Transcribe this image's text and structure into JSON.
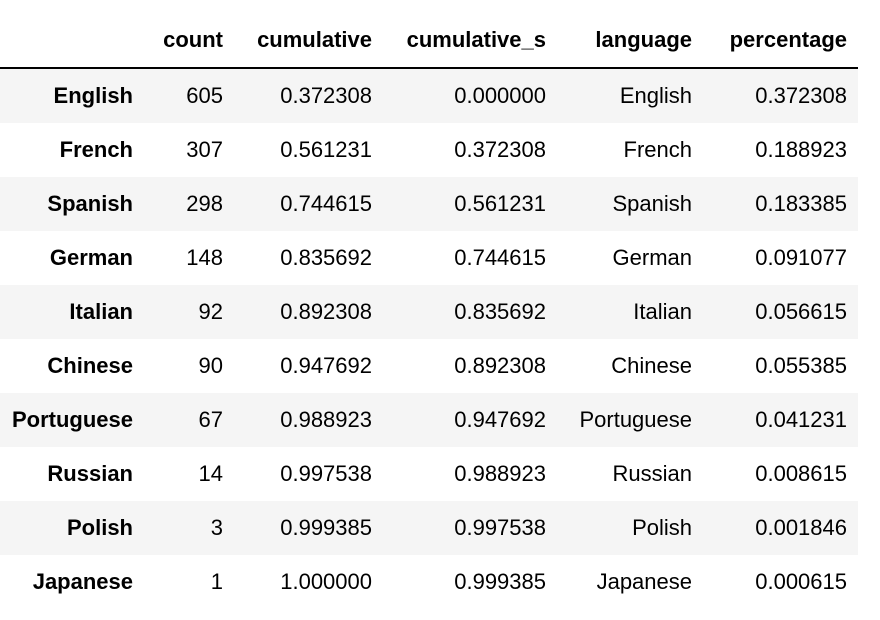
{
  "columns": [
    "",
    "count",
    "cumulative",
    "cumulative_s",
    "language",
    "percentage"
  ],
  "rows": [
    {
      "index": "English",
      "cells": [
        "605",
        "0.372308",
        "0.000000",
        "English",
        "0.372308"
      ]
    },
    {
      "index": "French",
      "cells": [
        "307",
        "0.561231",
        "0.372308",
        "French",
        "0.188923"
      ]
    },
    {
      "index": "Spanish",
      "cells": [
        "298",
        "0.744615",
        "0.561231",
        "Spanish",
        "0.183385"
      ]
    },
    {
      "index": "German",
      "cells": [
        "148",
        "0.835692",
        "0.744615",
        "German",
        "0.091077"
      ]
    },
    {
      "index": "Italian",
      "cells": [
        "92",
        "0.892308",
        "0.835692",
        "Italian",
        "0.056615"
      ]
    },
    {
      "index": "Chinese",
      "cells": [
        "90",
        "0.947692",
        "0.892308",
        "Chinese",
        "0.055385"
      ]
    },
    {
      "index": "Portuguese",
      "cells": [
        "67",
        "0.988923",
        "0.947692",
        "Portuguese",
        "0.041231"
      ]
    },
    {
      "index": "Russian",
      "cells": [
        "14",
        "0.997538",
        "0.988923",
        "Russian",
        "0.008615"
      ]
    },
    {
      "index": "Polish",
      "cells": [
        "3",
        "0.999385",
        "0.997538",
        "Polish",
        "0.001846"
      ]
    },
    {
      "index": "Japanese",
      "cells": [
        "1",
        "1.000000",
        "0.999385",
        "Japanese",
        "0.000615"
      ]
    }
  ]
}
